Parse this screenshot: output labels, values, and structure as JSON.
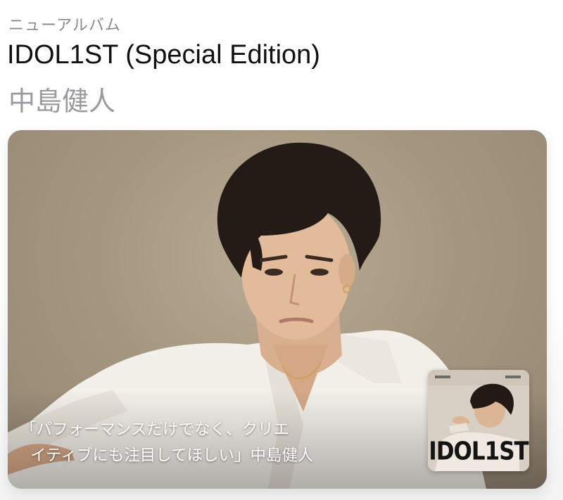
{
  "header": {
    "eyebrow": "ニューアルバム",
    "title": "IDOL1ST (Special Edition)",
    "artist": "中島健人"
  },
  "feature": {
    "caption_line1": "「パフォーマンスだけでなく、クリエ",
    "caption_line2": "イティブにも注目してほしい」中島健人",
    "album_logo": "IDOL1ST",
    "background_color": "#a69781"
  }
}
